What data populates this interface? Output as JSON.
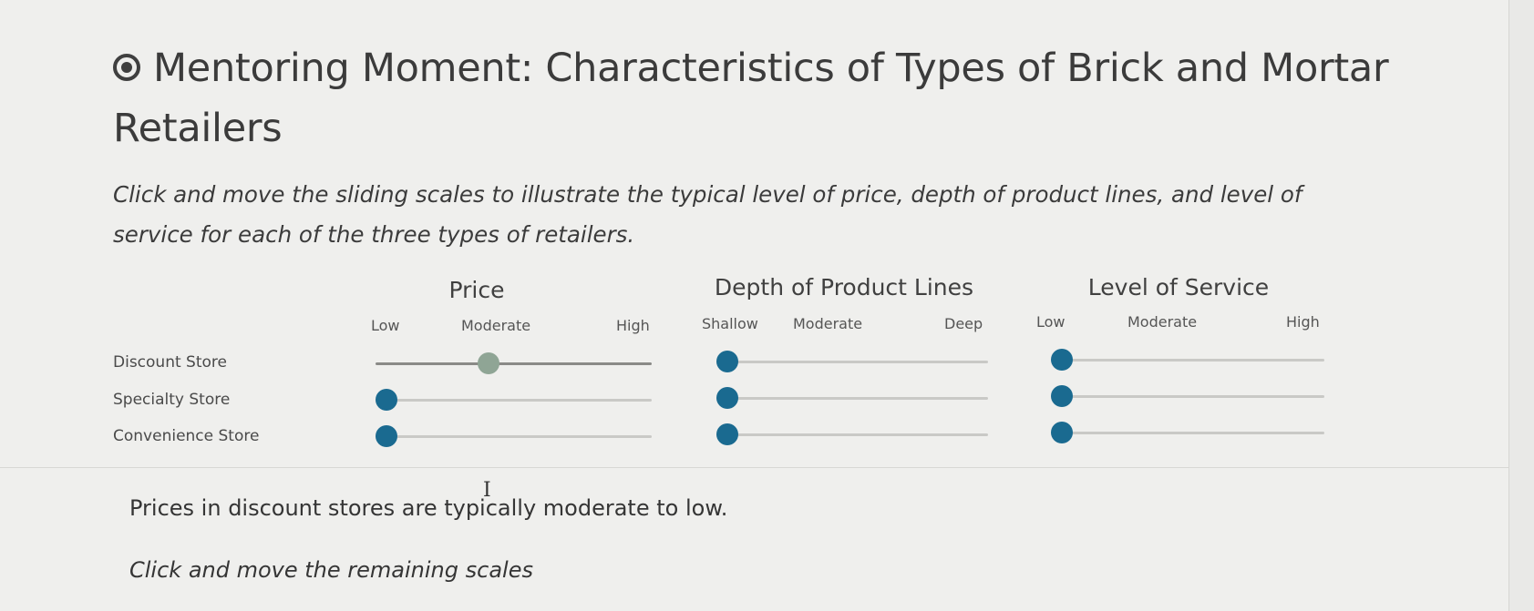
{
  "title": "Mentoring Moment: Characteristics of Types of Brick and Mortar Retailers",
  "instruction": "Click and move the sliding scales to illustrate the typical level of price, depth of product lines, and level of service for each of the three types of retailers.",
  "columns": [
    {
      "heading": "Price",
      "scale": [
        "Low",
        "Moderate",
        "High"
      ]
    },
    {
      "heading": "Depth of Product Lines",
      "scale": [
        "Shallow",
        "Moderate",
        "Deep"
      ]
    },
    {
      "heading": "Level of Service",
      "scale": [
        "Low",
        "Moderate",
        "High"
      ]
    }
  ],
  "rows": [
    {
      "label": "Discount Store",
      "values": [
        0.37,
        0,
        0
      ],
      "set": [
        true,
        false,
        false
      ]
    },
    {
      "label": "Specialty Store",
      "values": [
        0,
        0,
        0
      ],
      "set": [
        false,
        false,
        false
      ]
    },
    {
      "label": "Convenience Store",
      "values": [
        0,
        0,
        0
      ],
      "set": [
        false,
        false,
        false
      ]
    }
  ],
  "feedback": "Prices in discount stores are typically moderate to low.",
  "prompt": "Click and move the remaining scales",
  "colors": {
    "thumb": "#1a6a90",
    "thumb_set": "#8fa595",
    "track": "#c9c9c6"
  }
}
